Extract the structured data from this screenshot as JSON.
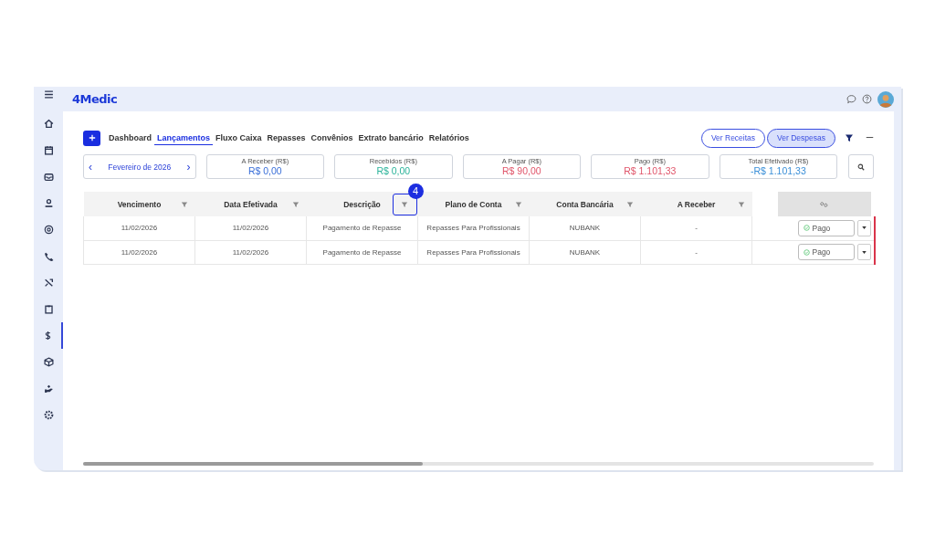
{
  "app": {
    "logo": "4Medic"
  },
  "sidebar": {
    "items": [
      {
        "selected": false
      },
      {
        "selected": false
      },
      {
        "selected": false
      },
      {
        "selected": false
      },
      {
        "selected": false
      },
      {
        "selected": false
      },
      {
        "selected": false
      },
      {
        "selected": false
      },
      {
        "selected": true
      },
      {
        "selected": false
      },
      {
        "selected": false
      },
      {
        "selected": false
      }
    ]
  },
  "tabs": [
    {
      "label": "Dashboard",
      "selected": false
    },
    {
      "label": "Lançamentos",
      "selected": true
    },
    {
      "label": "Fluxo Caixa",
      "selected": false
    },
    {
      "label": "Repasses",
      "selected": false
    },
    {
      "label": "Convênios",
      "selected": false
    },
    {
      "label": "Extrato bancário",
      "selected": false
    },
    {
      "label": "Relatórios",
      "selected": false
    }
  ],
  "view_buttons": [
    {
      "label": "Ver Receitas",
      "selected": false
    },
    {
      "label": "Ver Despesas",
      "selected": true
    }
  ],
  "period": {
    "label": "Fevereiro de 2026",
    "prev": "‹",
    "next": "›"
  },
  "cards": [
    {
      "label": "A Receber (R$)",
      "value": "R$ 0,00",
      "color": "#3a6fd8"
    },
    {
      "label": "Recebidos (R$)",
      "value": "R$ 0,00",
      "color": "#2bb39a"
    },
    {
      "label": "A Pagar (R$)",
      "value": "R$ 90,00",
      "color": "#e0556a"
    },
    {
      "label": "Pago (R$)",
      "value": "R$ 1.101,33",
      "color": "#e0556a"
    },
    {
      "label": "Total Efetivado (R$)",
      "value": "-R$ 1.101,33",
      "color": "#3a8fd8"
    }
  ],
  "table": {
    "columns": [
      {
        "label": "Vencimento",
        "highlighted": false
      },
      {
        "label": "Data Efetivada",
        "highlighted": false
      },
      {
        "label": "Descrição",
        "highlighted": true
      },
      {
        "label": "Plano de Conta",
        "highlighted": false
      },
      {
        "label": "Conta Bancária",
        "highlighted": false
      },
      {
        "label": "A Receber",
        "highlighted": false
      }
    ],
    "callout": "4",
    "rows": [
      {
        "cells": [
          "11/02/2026",
          "11/02/2026",
          "Pagamento de Repasse",
          "Repasses Para Profissionais",
          "NUBANK",
          "-"
        ],
        "status": "Pago",
        "color": "#d9344a"
      },
      {
        "cells": [
          "11/02/2026",
          "11/02/2026",
          "Pagamento de Repasse",
          "Repasses Para Profissionais",
          "NUBANK",
          "-"
        ],
        "status": "Pago",
        "color": "#d9344a"
      }
    ]
  }
}
